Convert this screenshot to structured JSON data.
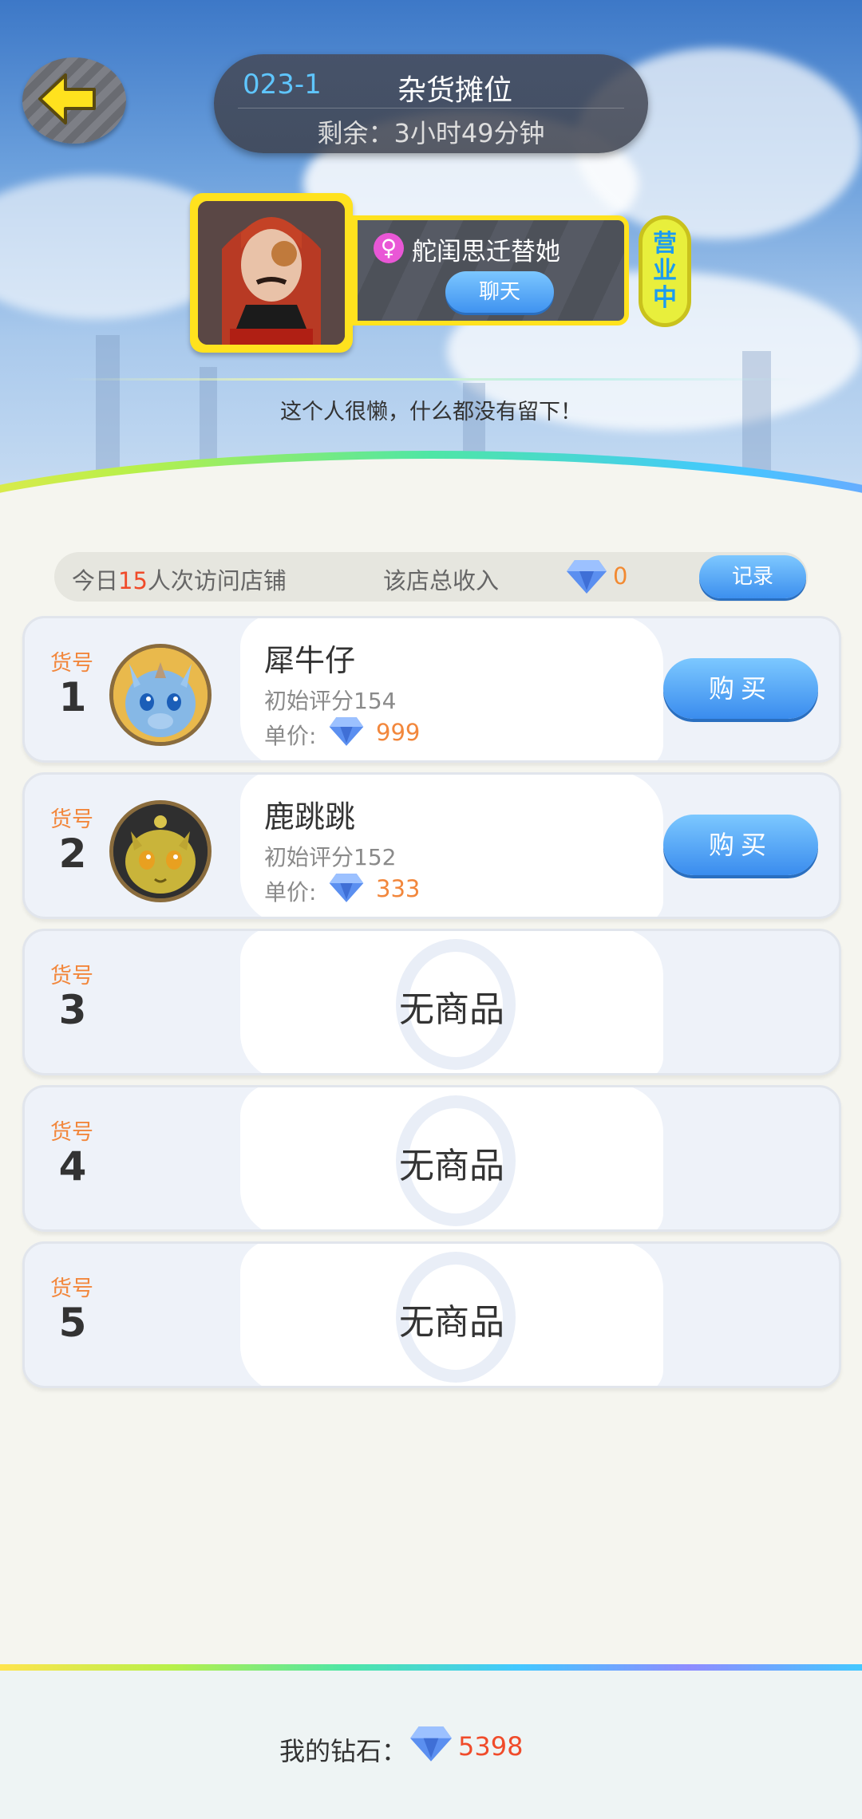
{
  "header": {
    "stall_code": "023-1",
    "stall_name": "杂货摊位",
    "remaining": "剩余：3小时49分钟",
    "owner_name": "舵闺思迁替她",
    "owner_gender_icon": "female-icon",
    "chat_label": "聊天",
    "status_badge": "营业中",
    "motto": "这个人很懒，什么都没有留下！"
  },
  "stats": {
    "visits_prefix": "今日",
    "visits_count": "15",
    "visits_suffix": "人次访问店铺",
    "income_label": "该店总收入",
    "income_value": "0",
    "record_label": "记录"
  },
  "slots": [
    {
      "label": "货号",
      "number": "1",
      "name": "犀牛仔",
      "score": "初始评分154",
      "price_label": "单价:",
      "price": "999",
      "buy_label": "购买",
      "pet_icon": "rhino-pet-icon"
    },
    {
      "label": "货号",
      "number": "2",
      "name": "鹿跳跳",
      "score": "初始评分152",
      "price_label": "单价:",
      "price": "333",
      "buy_label": "购买",
      "pet_icon": "deer-pet-icon"
    },
    {
      "label": "货号",
      "number": "3",
      "empty_text": "无商品"
    },
    {
      "label": "货号",
      "number": "4",
      "empty_text": "无商品"
    },
    {
      "label": "货号",
      "number": "5",
      "empty_text": "无商品"
    }
  ],
  "footer": {
    "diamond_label": "我的钻石：",
    "diamond_value": "5398"
  },
  "colors": {
    "accent_blue": "#3c8fee",
    "accent_orange": "#f2873c",
    "highlight_red": "#f04b2a",
    "status_yellow": "#e8ef3c"
  }
}
